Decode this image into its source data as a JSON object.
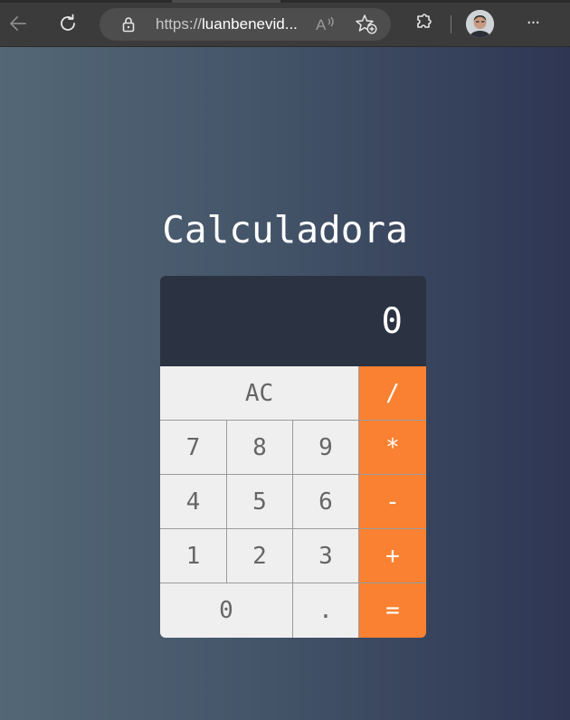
{
  "browser": {
    "url_scheme": "https://",
    "url_host": "luanbenevid...",
    "read_aloud_icon": "read-aloud-icon",
    "favorites_icon": "add-favorite-icon",
    "extensions_icon": "extensions-icon",
    "menu_label": "···"
  },
  "page": {
    "title": "Calculadora"
  },
  "calculator": {
    "display": "0",
    "keys": {
      "ac": "AC",
      "divide": "/",
      "seven": "7",
      "eight": "8",
      "nine": "9",
      "multiply": "*",
      "four": "4",
      "five": "5",
      "six": "6",
      "subtract": "-",
      "one": "1",
      "two": "2",
      "three": "3",
      "add": "+",
      "zero": "0",
      "decimal": ".",
      "equals": "="
    }
  },
  "colors": {
    "operator": "#f98131",
    "display_bg": "#2b3342",
    "key_bg": "#efefef",
    "gradient_start": "#536776",
    "gradient_end": "#2e3653"
  }
}
